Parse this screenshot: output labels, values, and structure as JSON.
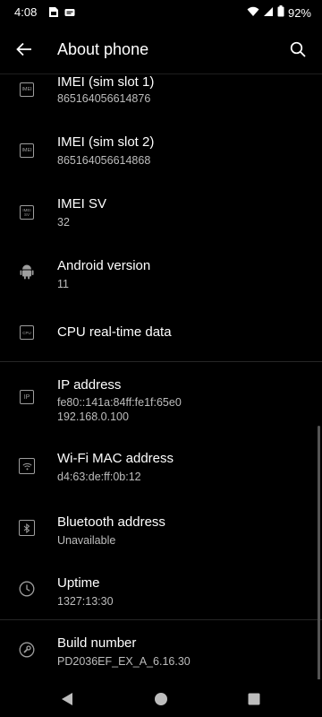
{
  "status_bar": {
    "time": "4:08",
    "battery": "92%",
    "icons": [
      "sim-icon",
      "notification-icon",
      "wifi-icon",
      "signal-icon",
      "battery-icon"
    ]
  },
  "app_bar": {
    "title": "About phone",
    "back_icon": "back-arrow-icon",
    "search_icon": "search-icon"
  },
  "items": [
    {
      "icon": "imei-icon",
      "icon_text": "IMEI",
      "title": "IMEI (sim slot 1)",
      "lines": [
        "865164056614876"
      ]
    },
    {
      "icon": "imei-icon",
      "icon_text": "IMEI",
      "title": "IMEI (sim slot 2)",
      "lines": [
        "865164056614868"
      ]
    },
    {
      "icon": "imei-sv-icon",
      "icon_text": "IMEI SV",
      "title": "IMEI SV",
      "lines": [
        "32"
      ]
    },
    {
      "icon": "android-icon",
      "title": "Android version",
      "lines": [
        "11"
      ]
    },
    {
      "icon": "cpu-icon",
      "icon_text": "CPU",
      "title": "CPU real-time data",
      "lines": []
    },
    {
      "icon": "ip-icon",
      "icon_text": "IP",
      "title": "IP address",
      "lines": [
        "fe80::141a:84ff:fe1f:65e0",
        "192.168.0.100"
      ]
    },
    {
      "icon": "wifi-icon",
      "title": "Wi-Fi MAC address",
      "lines": [
        "d4:63:de:ff:0b:12"
      ]
    },
    {
      "icon": "bluetooth-icon",
      "title": "Bluetooth address",
      "lines": [
        "Unavailable"
      ]
    },
    {
      "icon": "clock-icon",
      "title": "Uptime",
      "lines": [
        "1327:13:30"
      ]
    },
    {
      "icon": "wrench-icon",
      "title": "Build number",
      "lines": [
        "PD2036EF_EX_A_6.16.30"
      ]
    }
  ],
  "nav_bar": {
    "back": "nav-back-icon",
    "home": "nav-home-icon",
    "recents": "nav-recents-icon"
  }
}
